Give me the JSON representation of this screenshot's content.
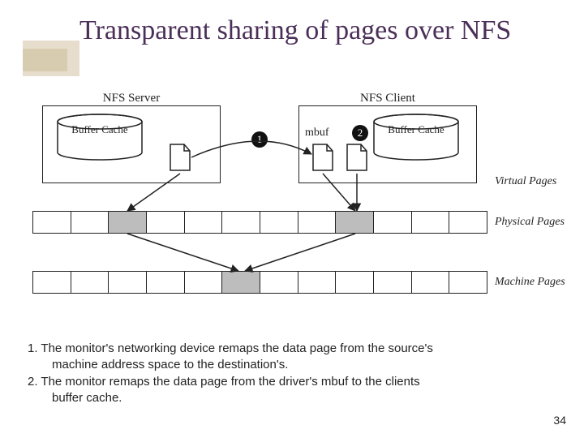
{
  "title": "Transparent sharing of pages over NFS",
  "diagram": {
    "server_label": "NFS Server",
    "client_label": "NFS Client",
    "buffer_cache_label": "Buffer Cache",
    "mbuf_label": "mbuf",
    "step1": "1",
    "step2": "2",
    "side_virtual": "Virtual Pages",
    "side_physical": "Physical Pages",
    "side_machine": "Machine Pages"
  },
  "caption": {
    "line1a": "1.  The monitor's networking device remaps the data page from the source's",
    "line1b": "machine address space to the destination's.",
    "line2a": "2. The monitor remaps the data page from the driver's mbuf to the clients",
    "line2b": "buffer cache."
  },
  "page_number": "34"
}
